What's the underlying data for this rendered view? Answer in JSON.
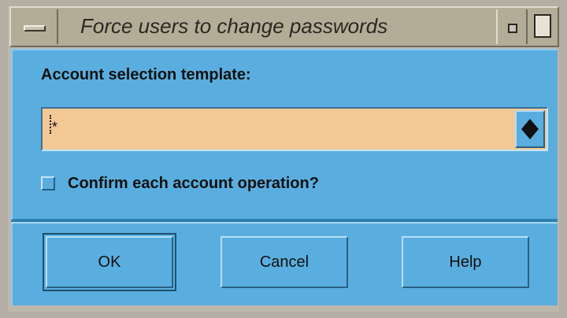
{
  "window": {
    "title": "Force users to change passwords"
  },
  "form": {
    "template_label": "Account selection template:",
    "template_value": "*",
    "confirm_label": "Confirm each account operation?",
    "confirm_checked": false
  },
  "buttons": {
    "ok": "OK",
    "cancel": "Cancel",
    "help": "Help"
  },
  "colors": {
    "panel": "#5aaedf",
    "input": "#f2c895",
    "titlebar": "#b3ad98"
  },
  "icons": {
    "window_menu": "window-menu-icon",
    "minimize": "minimize-icon",
    "maximize": "maximize-icon",
    "combo_arrow": "updown-arrow-icon"
  }
}
